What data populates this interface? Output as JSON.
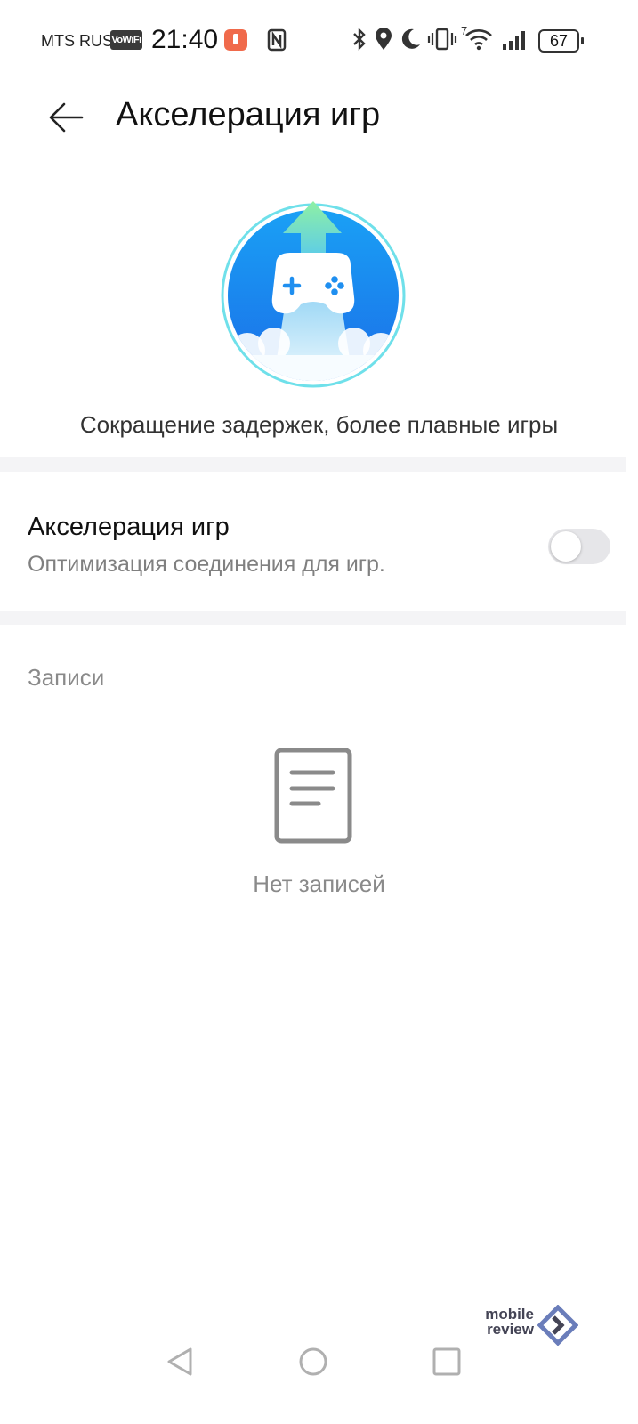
{
  "status_bar": {
    "carrier": "MTS RUS",
    "vowifi": "VoWiFi",
    "time": "21:40",
    "network_type": "7",
    "battery": "67",
    "icons": [
      "alert-icon",
      "nfc-icon",
      "bluetooth-icon",
      "location-icon",
      "moon-icon",
      "vibrate-icon",
      "wifi-icon",
      "signal-icon",
      "battery-icon"
    ]
  },
  "header": {
    "title": "Акселерация игр",
    "back_icon": "arrow-left-icon"
  },
  "hero": {
    "icon": "gamepad-acceleration-icon",
    "caption": "Сокращение задержек, более плавные игры"
  },
  "setting": {
    "title": "Акселерация игр",
    "subtitle": "Оптимизация соединения для игр.",
    "enabled": false
  },
  "records": {
    "section_label": "Записи",
    "empty_icon": "document-icon",
    "empty_text": "Нет записей"
  },
  "watermark": {
    "line1": "mobile",
    "line2": "review"
  },
  "nav_bar": {
    "icons": [
      "back-triangle-icon",
      "home-circle-icon",
      "recents-square-icon"
    ]
  },
  "colors": {
    "hero_blue": "#1e8ff0",
    "hero_arrow": "#7ee3a6",
    "toggle_off": "#e6e6e9",
    "divider": "#f4f4f6",
    "secondary_text": "#808080"
  }
}
